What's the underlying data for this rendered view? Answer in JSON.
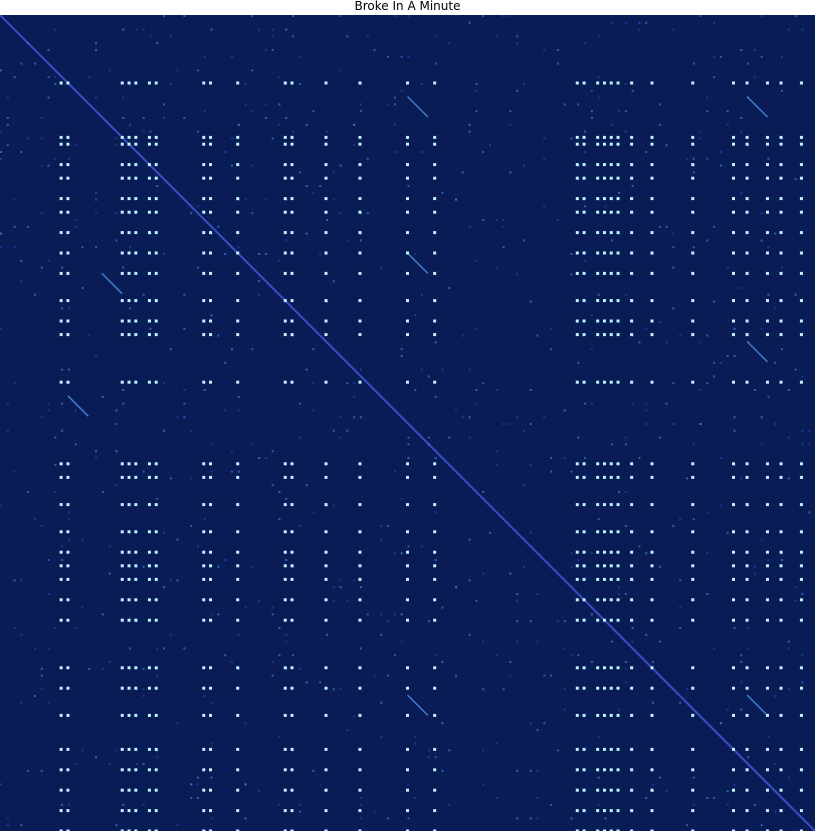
{
  "chart_data": {
    "type": "heatmap",
    "title": "Broke In A Minute",
    "xlabel": "",
    "ylabel": "",
    "grid": false,
    "legend": "none",
    "colors": {
      "background": "#0a1c56",
      "diagonal": "#3b4cc6",
      "weak": "#2a3fb0",
      "medium": "#3f7ccf",
      "strong": "#bff3ff"
    },
    "size": 120,
    "strong_index_groups": [
      9,
      10,
      18,
      19,
      20,
      22,
      23,
      30,
      31,
      35,
      42,
      43,
      48,
      53,
      60,
      64,
      85,
      86,
      88,
      89,
      90,
      91,
      93,
      96,
      102,
      108,
      110,
      113,
      115,
      118
    ],
    "strong_row_groups": [
      10,
      18,
      19,
      22,
      24,
      27,
      29,
      32,
      35,
      38,
      42,
      45,
      47,
      54,
      66,
      68,
      72,
      76,
      79,
      81,
      83,
      86,
      89,
      96,
      99,
      103,
      108,
      111,
      114,
      117,
      120
    ],
    "diagonal_value": 0.4,
    "recurrence_value": 1.0
  }
}
